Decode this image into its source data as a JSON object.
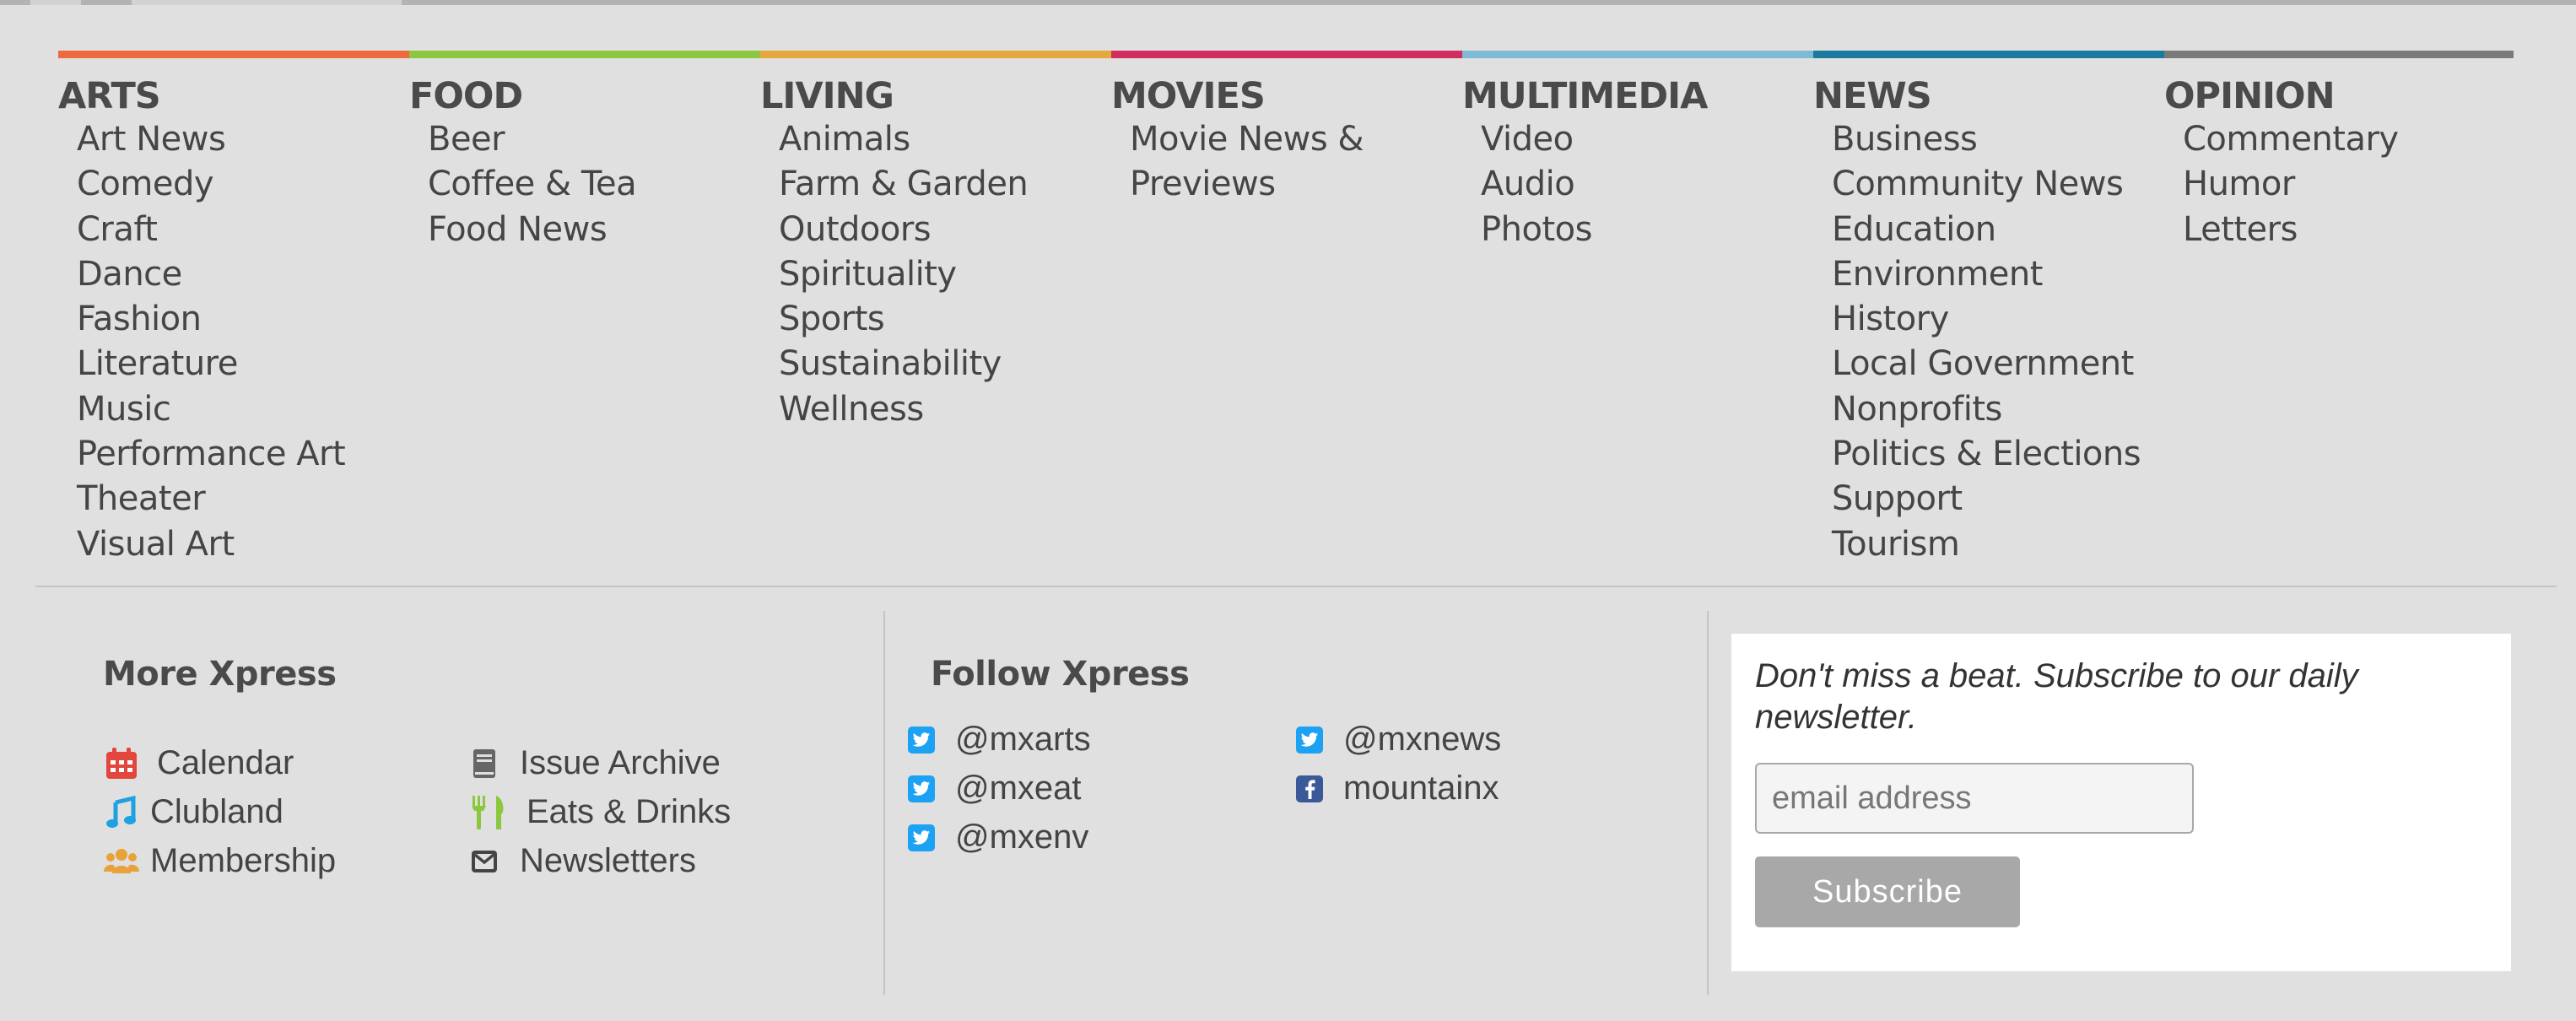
{
  "categories": [
    {
      "title": "ARTS",
      "color": "#ef6a3a",
      "items": [
        "Art News",
        "Comedy",
        "Craft",
        "Dance",
        "Fashion",
        "Literature",
        "Music",
        "Performance Art",
        "Theater",
        "Visual Art"
      ]
    },
    {
      "title": "FOOD",
      "color": "#8dc63f",
      "items": [
        "Beer",
        "Coffee & Tea",
        "Food News"
      ]
    },
    {
      "title": "LIVING",
      "color": "#e6a83a",
      "items": [
        "Animals",
        "Farm & Garden",
        "Outdoors",
        "Spirituality",
        "Sports",
        "Sustainability",
        "Wellness"
      ]
    },
    {
      "title": "MOVIES",
      "color": "#d12d5e",
      "items": [
        "Movie News &",
        "Previews"
      ]
    },
    {
      "title": "MULTIMEDIA",
      "color": "#7fbad4",
      "items": [
        "Video",
        "Audio",
        "Photos"
      ]
    },
    {
      "title": "NEWS",
      "color": "#1b7a9e",
      "items": [
        "Business",
        "Community News",
        "Education",
        "Environment",
        "History",
        "Local Government",
        "Nonprofits",
        "Politics & Elections",
        "Support",
        "Tourism"
      ]
    },
    {
      "title": "OPINION",
      "color": "#7a7a7a",
      "items": [
        "Commentary",
        "Humor",
        "Letters"
      ]
    }
  ],
  "more": {
    "title": "More Xpress",
    "links": [
      {
        "label": "Calendar",
        "icon": "calendar-icon",
        "color": "#e2463c"
      },
      {
        "label": "Clubland",
        "icon": "music-note-icon",
        "color": "#1da1e0"
      },
      {
        "label": "Membership",
        "icon": "users-icon",
        "color": "#e8a23a"
      },
      {
        "label": "Issue Archive",
        "icon": "book-icon",
        "color": "#666666"
      },
      {
        "label": "Eats & Drinks",
        "icon": "utensils-icon",
        "color": "#8dc63f"
      },
      {
        "label": "Newsletters",
        "icon": "envelope-icon",
        "color": "#444444"
      }
    ]
  },
  "follow": {
    "title": "Follow Xpress",
    "links": [
      {
        "label": "@mxarts",
        "icon": "twitter-icon"
      },
      {
        "label": "@mxeat",
        "icon": "twitter-icon"
      },
      {
        "label": "@mxenv",
        "icon": "twitter-icon"
      },
      {
        "label": "@mxnews",
        "icon": "twitter-icon"
      },
      {
        "label": "mountainx",
        "icon": "facebook-icon"
      }
    ]
  },
  "subscribe": {
    "text": "Don't miss a beat. Subscribe to our daily newsletter.",
    "placeholder": "email address",
    "button_label": "Subscribe"
  }
}
